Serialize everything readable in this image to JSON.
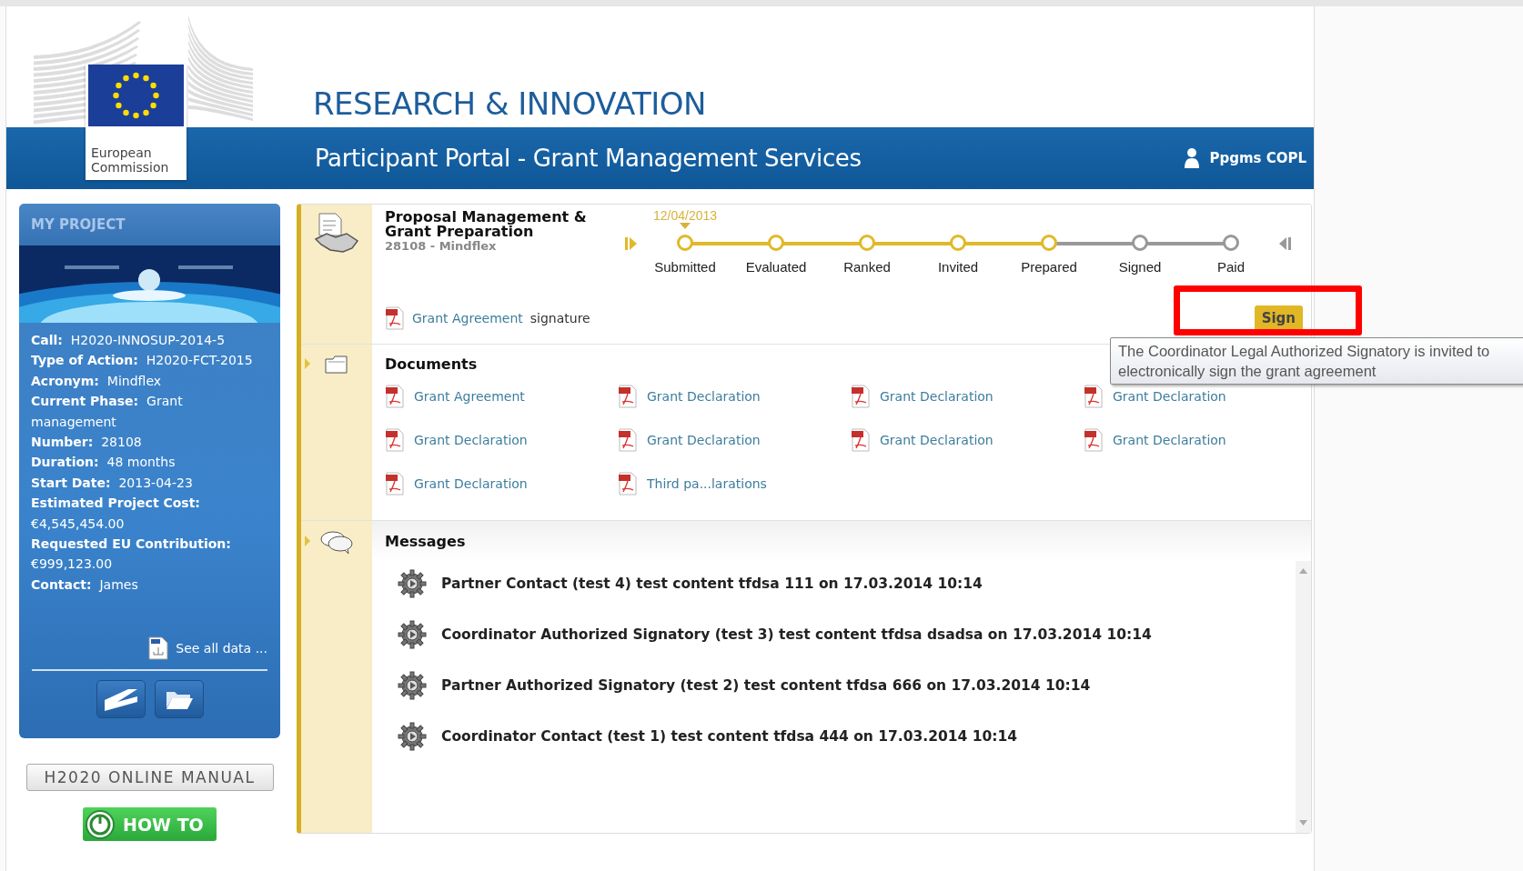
{
  "header": {
    "logo_text": "European Commission",
    "title": "RESEARCH & INNOVATION",
    "subtitle": "Participant Portal - Grant Management Services",
    "user": "Ppgms COPL"
  },
  "project": {
    "heading": "MY PROJECT",
    "fields": [
      {
        "label": "Call:",
        "value": "H2020-INNOSUP-2014-5"
      },
      {
        "label": "Type of Action:",
        "value": "H2020-FCT-2015"
      },
      {
        "label": "Acronym:",
        "value": "Mindflex"
      },
      {
        "label": "Current Phase:",
        "value": "Grant management"
      },
      {
        "label": "Number:",
        "value": "28108"
      },
      {
        "label": "Duration:",
        "value": "48 months"
      },
      {
        "label": "Start Date:",
        "value": "2013-04-23"
      },
      {
        "label": "Estimated Project Cost:",
        "value": "€4,545,454.00"
      },
      {
        "label": "Requested EU Contribution:",
        "value": "€999,123.00"
      },
      {
        "label": "Contact:",
        "value": "James"
      }
    ],
    "see_all": "See all data ...",
    "manual": "H2020 ONLINE MANUAL",
    "howto": "HOW TO"
  },
  "workflow": {
    "title": "Proposal Management & Grant Preparation",
    "subtitle": "28108 - Mindflex",
    "date": "12/04/2013",
    "stages": [
      {
        "label": "Submitted",
        "done": true
      },
      {
        "label": "Evaluated",
        "done": true
      },
      {
        "label": "Ranked",
        "done": true
      },
      {
        "label": "Invited",
        "done": true
      },
      {
        "label": "Prepared",
        "done": true
      },
      {
        "label": "Signed",
        "done": false
      },
      {
        "label": "Paid",
        "done": false
      }
    ],
    "action": {
      "link": "Grant Agreement",
      "text": "signature",
      "button": "Sign",
      "highlighted": true
    },
    "tooltip": "The Coordinator Legal Authorized Signatory is invited to electronically sign the grant agreement"
  },
  "documents": {
    "title": "Documents",
    "items": [
      "Grant Agreement",
      "Grant Declaration",
      "Grant Declaration",
      "Grant Declaration",
      "Grant Declaration",
      "Grant Declaration",
      "Grant Declaration",
      "Grant Declaration",
      "Grant Declaration",
      "Third pa...larations"
    ]
  },
  "messages": {
    "title": "Messages",
    "items": [
      "Partner Contact (test 4) test content tfdsa 111 on 17.03.2014 10:14",
      "Coordinator Authorized Signatory (test 3) test content tfdsa dsadsa on 17.03.2014 10:14",
      "Partner Authorized Signatory (test 2) test content tfdsa 666 on 17.03.2014 10:14",
      "Coordinator Contact (test 1) test content tfdsa 444 on 17.03.2014 10:14"
    ]
  }
}
